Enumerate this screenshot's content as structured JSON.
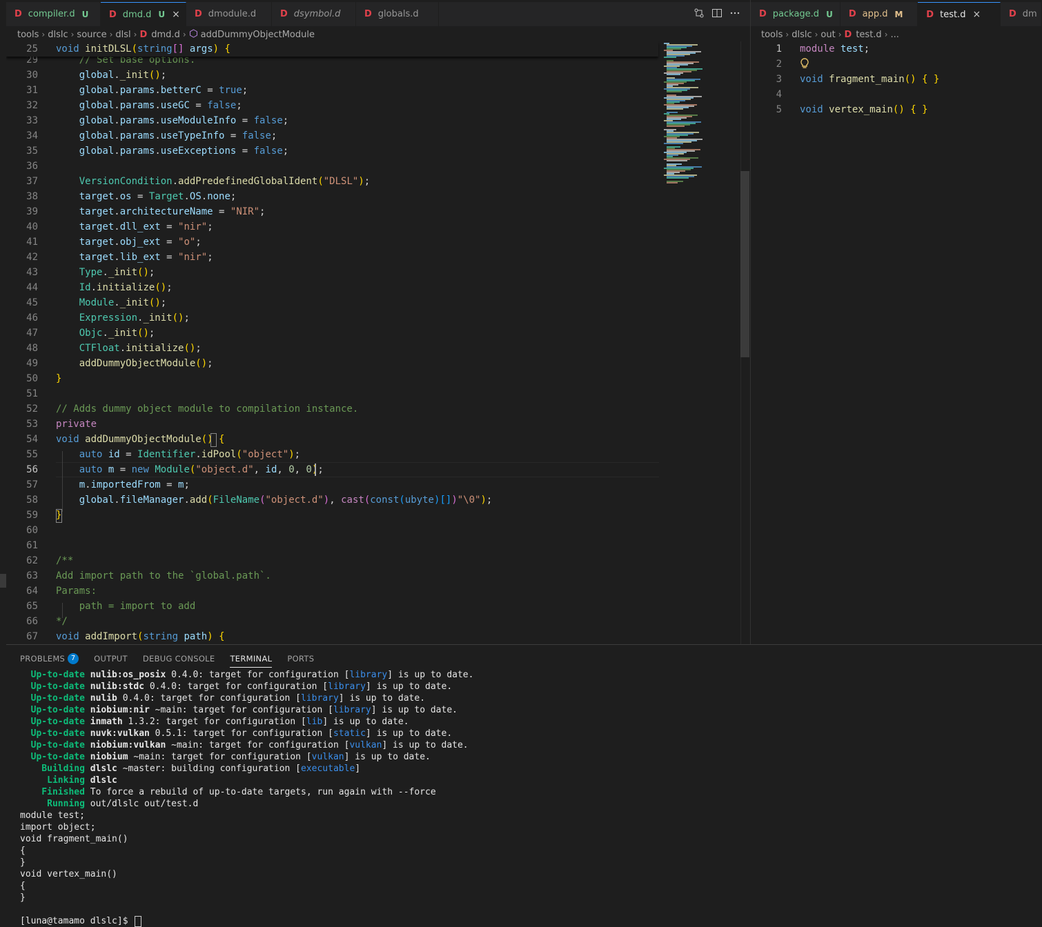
{
  "left_tabs": [
    {
      "label": "compiler.d",
      "badge": "U",
      "style": "mod-u",
      "active": false
    },
    {
      "label": "dmd.d",
      "badge": "U",
      "style": "mod-u",
      "active": true,
      "close": "×"
    },
    {
      "label": "dmodule.d",
      "badge": "",
      "style": "",
      "active": false
    },
    {
      "label": "dsymbol.d",
      "badge": "",
      "style": "ital",
      "active": false
    },
    {
      "label": "globals.d",
      "badge": "",
      "style": "",
      "active": false
    }
  ],
  "right_tabs": [
    {
      "label": "package.d",
      "badge": "U",
      "style": "mod-u",
      "active": false
    },
    {
      "label": "app.d",
      "badge": "M",
      "style": "mod-m",
      "active": false
    },
    {
      "label": "test.d",
      "badge": "",
      "style": "",
      "active": true,
      "close": "×"
    },
    {
      "label": "dm",
      "badge": "",
      "style": "",
      "active": false
    }
  ],
  "file_glyph": "D",
  "left_breadcrumb": {
    "parts": [
      "tools",
      "dlslc",
      "source",
      "dlsl"
    ],
    "file": "dmd.d",
    "symbol": "addDummyObjectModule"
  },
  "right_breadcrumb": {
    "parts": [
      "tools",
      "dlslc",
      "out"
    ],
    "file": "test.d",
    "tail": "..."
  },
  "left_editor": {
    "sticky": {
      "num": "25",
      "code": "void initDLSL(string[] args) {"
    },
    "lines": [
      {
        "num": "29",
        "code": "    // Set base options."
      },
      {
        "num": "30",
        "code": "    global._init();"
      },
      {
        "num": "31",
        "code": "    global.params.betterC = true;"
      },
      {
        "num": "32",
        "code": "    global.params.useGC = false;"
      },
      {
        "num": "33",
        "code": "    global.params.useModuleInfo = false;"
      },
      {
        "num": "34",
        "code": "    global.params.useTypeInfo = false;"
      },
      {
        "num": "35",
        "code": "    global.params.useExceptions = false;"
      },
      {
        "num": "36",
        "code": ""
      },
      {
        "num": "37",
        "code": "    VersionCondition.addPredefinedGlobalIdent(\"DLSL\");"
      },
      {
        "num": "38",
        "code": "    target.os = Target.OS.none;"
      },
      {
        "num": "39",
        "code": "    target.architectureName = \"NIR\";"
      },
      {
        "num": "40",
        "code": "    target.dll_ext = \"nir\";"
      },
      {
        "num": "41",
        "code": "    target.obj_ext = \"o\";"
      },
      {
        "num": "42",
        "code": "    target.lib_ext = \"nir\";"
      },
      {
        "num": "43",
        "code": "    Type._init();"
      },
      {
        "num": "44",
        "code": "    Id.initialize();"
      },
      {
        "num": "45",
        "code": "    Module._init();"
      },
      {
        "num": "46",
        "code": "    Expression._init();"
      },
      {
        "num": "47",
        "code": "    Objc._init();"
      },
      {
        "num": "48",
        "code": "    CTFloat.initialize();"
      },
      {
        "num": "49",
        "code": "    addDummyObjectModule();"
      },
      {
        "num": "50",
        "code": "}"
      },
      {
        "num": "51",
        "code": ""
      },
      {
        "num": "52",
        "code": "// Adds dummy object module to compilation instance."
      },
      {
        "num": "53",
        "code": "private"
      },
      {
        "num": "54",
        "code": "void addDummyObjectModule() {"
      },
      {
        "num": "55",
        "code": "    auto id = Identifier.idPool(\"object\");"
      },
      {
        "num": "56",
        "code": "    auto m = new Module(\"object.d\", id, 0, 0);"
      },
      {
        "num": "57",
        "code": "    m.importedFrom = m;"
      },
      {
        "num": "58",
        "code": "    global.fileManager.add(FileName(\"object.d\"), cast(const(ubyte)[])\"\\0\");"
      },
      {
        "num": "59",
        "code": "}"
      },
      {
        "num": "60",
        "code": ""
      },
      {
        "num": "61",
        "code": ""
      },
      {
        "num": "62",
        "code": "/**"
      },
      {
        "num": "63",
        "code": "Add import path to the `global.path`."
      },
      {
        "num": "64",
        "code": "Params:"
      },
      {
        "num": "65",
        "code": "    path = import to add"
      },
      {
        "num": "66",
        "code": "*/"
      },
      {
        "num": "67",
        "code": "void addImport(string path) {"
      }
    ]
  },
  "right_editor": {
    "lines": [
      {
        "num": "1",
        "code": "module test;"
      },
      {
        "num": "2",
        "code": ""
      },
      {
        "num": "3",
        "code": "void fragment_main() { }"
      },
      {
        "num": "4",
        "code": ""
      },
      {
        "num": "5",
        "code": "void vertex_main() { }"
      }
    ],
    "lightbulb_line": "2"
  },
  "panel": {
    "tabs": [
      {
        "label": "PROBLEMS",
        "badge": "7",
        "active": false
      },
      {
        "label": "OUTPUT",
        "active": false
      },
      {
        "label": "DEBUG CONSOLE",
        "active": false
      },
      {
        "label": "TERMINAL",
        "active": true
      },
      {
        "label": "PORTS",
        "active": false
      }
    ]
  },
  "terminal": {
    "lines": [
      {
        "status": "  Up-to-date",
        "name": "nulib:os_posix",
        "rest": " 0.4.0: target for configuration [",
        "cfg": "library",
        "end": "] is up to date."
      },
      {
        "status": "  Up-to-date",
        "name": "nulib:stdc",
        "rest": " 0.4.0: target for configuration [",
        "cfg": "library",
        "end": "] is up to date."
      },
      {
        "status": "  Up-to-date",
        "name": "nulib",
        "rest": " 0.4.0: target for configuration [",
        "cfg": "library",
        "end": "] is up to date."
      },
      {
        "status": "  Up-to-date",
        "name": "niobium:nir",
        "rest": " ~main: target for configuration [",
        "cfg": "library",
        "end": "] is up to date."
      },
      {
        "status": "  Up-to-date",
        "name": "inmath",
        "rest": " 1.3.2: target for configuration [",
        "cfg": "lib",
        "end": "] is up to date."
      },
      {
        "status": "  Up-to-date",
        "name": "nuvk:vulkan",
        "rest": " 0.5.1: target for configuration [",
        "cfg": "static",
        "end": "] is up to date."
      },
      {
        "status": "  Up-to-date",
        "name": "niobium:vulkan",
        "rest": " ~main: target for configuration [",
        "cfg": "vulkan",
        "end": "] is up to date."
      },
      {
        "status": "  Up-to-date",
        "name": "niobium",
        "rest": " ~main: target for configuration [",
        "cfg": "vulkan",
        "end": "] is up to date."
      },
      {
        "status": "    Building",
        "name": "dlslc",
        "rest": " ~master: building configuration [",
        "cfg": "executable",
        "end": "]"
      },
      {
        "status": "     Linking",
        "name": "dlslc",
        "rest": "",
        "cfg": "",
        "end": ""
      },
      {
        "status": "    Finished",
        "name": "",
        "rest": "To force a rebuild of up-to-date targets, run again with --force",
        "cfg": "",
        "end": ""
      },
      {
        "status": "     Running",
        "name": "",
        "rest": "out/dlslc out/test.d",
        "cfg": "",
        "end": ""
      }
    ],
    "output": [
      "module test;",
      "import object;",
      "void fragment_main()",
      "{",
      "}",
      "void vertex_main()",
      "{",
      "}",
      "",
      "[luna@tamamo dlslc]$ "
    ]
  },
  "icons": [
    "compare-changes-icon",
    "split-editor-icon",
    "more-actions-icon",
    "lightbulb-icon",
    "method-symbol-icon",
    "chevron-right-icon"
  ]
}
